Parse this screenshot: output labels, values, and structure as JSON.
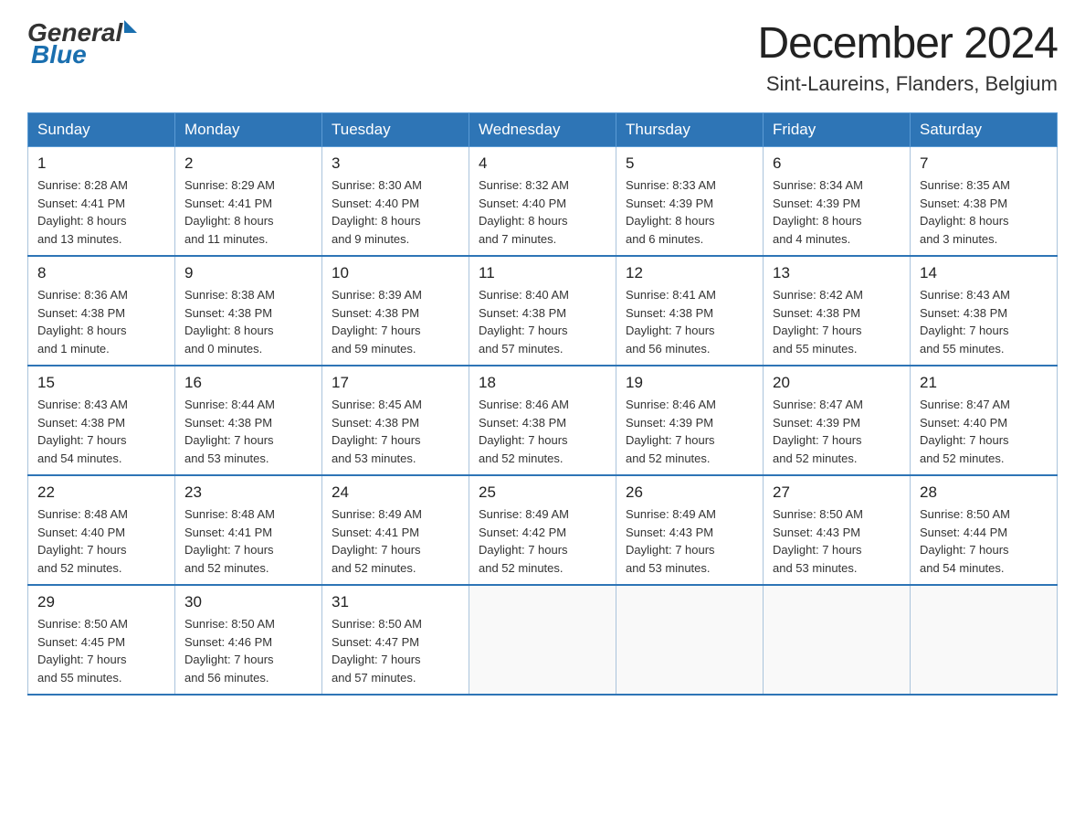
{
  "header": {
    "logo_general": "General",
    "logo_blue": "Blue",
    "title": "December 2024",
    "subtitle": "Sint-Laureins, Flanders, Belgium"
  },
  "days_of_week": [
    "Sunday",
    "Monday",
    "Tuesday",
    "Wednesday",
    "Thursday",
    "Friday",
    "Saturday"
  ],
  "weeks": [
    [
      {
        "day": "1",
        "info": "Sunrise: 8:28 AM\nSunset: 4:41 PM\nDaylight: 8 hours\nand 13 minutes."
      },
      {
        "day": "2",
        "info": "Sunrise: 8:29 AM\nSunset: 4:41 PM\nDaylight: 8 hours\nand 11 minutes."
      },
      {
        "day": "3",
        "info": "Sunrise: 8:30 AM\nSunset: 4:40 PM\nDaylight: 8 hours\nand 9 minutes."
      },
      {
        "day": "4",
        "info": "Sunrise: 8:32 AM\nSunset: 4:40 PM\nDaylight: 8 hours\nand 7 minutes."
      },
      {
        "day": "5",
        "info": "Sunrise: 8:33 AM\nSunset: 4:39 PM\nDaylight: 8 hours\nand 6 minutes."
      },
      {
        "day": "6",
        "info": "Sunrise: 8:34 AM\nSunset: 4:39 PM\nDaylight: 8 hours\nand 4 minutes."
      },
      {
        "day": "7",
        "info": "Sunrise: 8:35 AM\nSunset: 4:38 PM\nDaylight: 8 hours\nand 3 minutes."
      }
    ],
    [
      {
        "day": "8",
        "info": "Sunrise: 8:36 AM\nSunset: 4:38 PM\nDaylight: 8 hours\nand 1 minute."
      },
      {
        "day": "9",
        "info": "Sunrise: 8:38 AM\nSunset: 4:38 PM\nDaylight: 8 hours\nand 0 minutes."
      },
      {
        "day": "10",
        "info": "Sunrise: 8:39 AM\nSunset: 4:38 PM\nDaylight: 7 hours\nand 59 minutes."
      },
      {
        "day": "11",
        "info": "Sunrise: 8:40 AM\nSunset: 4:38 PM\nDaylight: 7 hours\nand 57 minutes."
      },
      {
        "day": "12",
        "info": "Sunrise: 8:41 AM\nSunset: 4:38 PM\nDaylight: 7 hours\nand 56 minutes."
      },
      {
        "day": "13",
        "info": "Sunrise: 8:42 AM\nSunset: 4:38 PM\nDaylight: 7 hours\nand 55 minutes."
      },
      {
        "day": "14",
        "info": "Sunrise: 8:43 AM\nSunset: 4:38 PM\nDaylight: 7 hours\nand 55 minutes."
      }
    ],
    [
      {
        "day": "15",
        "info": "Sunrise: 8:43 AM\nSunset: 4:38 PM\nDaylight: 7 hours\nand 54 minutes."
      },
      {
        "day": "16",
        "info": "Sunrise: 8:44 AM\nSunset: 4:38 PM\nDaylight: 7 hours\nand 53 minutes."
      },
      {
        "day": "17",
        "info": "Sunrise: 8:45 AM\nSunset: 4:38 PM\nDaylight: 7 hours\nand 53 minutes."
      },
      {
        "day": "18",
        "info": "Sunrise: 8:46 AM\nSunset: 4:38 PM\nDaylight: 7 hours\nand 52 minutes."
      },
      {
        "day": "19",
        "info": "Sunrise: 8:46 AM\nSunset: 4:39 PM\nDaylight: 7 hours\nand 52 minutes."
      },
      {
        "day": "20",
        "info": "Sunrise: 8:47 AM\nSunset: 4:39 PM\nDaylight: 7 hours\nand 52 minutes."
      },
      {
        "day": "21",
        "info": "Sunrise: 8:47 AM\nSunset: 4:40 PM\nDaylight: 7 hours\nand 52 minutes."
      }
    ],
    [
      {
        "day": "22",
        "info": "Sunrise: 8:48 AM\nSunset: 4:40 PM\nDaylight: 7 hours\nand 52 minutes."
      },
      {
        "day": "23",
        "info": "Sunrise: 8:48 AM\nSunset: 4:41 PM\nDaylight: 7 hours\nand 52 minutes."
      },
      {
        "day": "24",
        "info": "Sunrise: 8:49 AM\nSunset: 4:41 PM\nDaylight: 7 hours\nand 52 minutes."
      },
      {
        "day": "25",
        "info": "Sunrise: 8:49 AM\nSunset: 4:42 PM\nDaylight: 7 hours\nand 52 minutes."
      },
      {
        "day": "26",
        "info": "Sunrise: 8:49 AM\nSunset: 4:43 PM\nDaylight: 7 hours\nand 53 minutes."
      },
      {
        "day": "27",
        "info": "Sunrise: 8:50 AM\nSunset: 4:43 PM\nDaylight: 7 hours\nand 53 minutes."
      },
      {
        "day": "28",
        "info": "Sunrise: 8:50 AM\nSunset: 4:44 PM\nDaylight: 7 hours\nand 54 minutes."
      }
    ],
    [
      {
        "day": "29",
        "info": "Sunrise: 8:50 AM\nSunset: 4:45 PM\nDaylight: 7 hours\nand 55 minutes."
      },
      {
        "day": "30",
        "info": "Sunrise: 8:50 AM\nSunset: 4:46 PM\nDaylight: 7 hours\nand 56 minutes."
      },
      {
        "day": "31",
        "info": "Sunrise: 8:50 AM\nSunset: 4:47 PM\nDaylight: 7 hours\nand 57 minutes."
      },
      {
        "day": "",
        "info": ""
      },
      {
        "day": "",
        "info": ""
      },
      {
        "day": "",
        "info": ""
      },
      {
        "day": "",
        "info": ""
      }
    ]
  ]
}
